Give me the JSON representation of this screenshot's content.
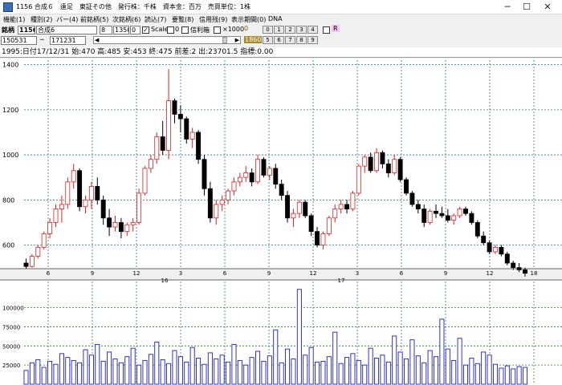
{
  "window": {
    "title": "1156 合成６　遠足　東証その他　発行株：千株　資本金：百万　売買単位：1株",
    "minimize": "─",
    "maximize": "☐",
    "close": "✕"
  },
  "menu": [
    "機能(1)",
    "種別(2)",
    "バー(4)",
    "前銘柄(5)",
    "次銘柄(6)",
    "読込(7)",
    "要覧(8)",
    "信用残(9)",
    "表示期間(0)",
    "DNA"
  ],
  "toolbar": {
    "code_label": "銘柄",
    "code_value": "1156",
    "name_value": "合成6",
    "field_a": "8",
    "field_b": "1350",
    "field_c": "0",
    "scale_label": "Scale",
    "field_d": "0",
    "credit_label": "信利箱",
    "x1000_label": "×1000",
    "num_top": "0",
    "num_badge": "1860",
    "buttons_row1": [
      "0",
      "1",
      "2",
      "3",
      "4"
    ],
    "buttons_row2": [
      "5",
      "6",
      "7",
      "8",
      "9"
    ],
    "r_label": "R",
    "start_date": "150531",
    "dash": "─",
    "end_date": "171231",
    "scroll_left": "◀",
    "scroll_right": "▶"
  },
  "infobar": "1995:日付17/12/31 始:470 高:485 安:453 終:475 前差:2 出:23701.5 指標:0.00",
  "colors": {
    "up": "#dd2222",
    "down": "#000000",
    "grid": "#2c7a86",
    "volume": "#1c1ccc",
    "bg": "#ffffff"
  },
  "chart_data": {
    "type": "candlestick",
    "price_ticks": [
      600,
      800,
      1000,
      1200,
      1400
    ],
    "price_range": [
      520,
      1420
    ],
    "month_ticks": [
      "6",
      "9",
      "12",
      "3",
      "6",
      "9",
      "12",
      "3",
      "6",
      "9",
      "12",
      "18"
    ],
    "year_labels": [
      {
        "label": "16",
        "month_index": 2
      },
      {
        "label": "17",
        "month_index": 6
      },
      {
        "label": "18",
        "month_index": 11
      }
    ],
    "volume_ticks": [
      25000,
      50000,
      75000,
      100000
    ],
    "volume_labels": [
      "25000",
      "50000",
      "75000",
      "100000"
    ],
    "volume_range": [
      0,
      130000
    ],
    "start_month_index": -0.5,
    "candles": [
      [
        520,
        540,
        495,
        505
      ],
      [
        505,
        560,
        500,
        550
      ],
      [
        550,
        600,
        540,
        590
      ],
      [
        590,
        660,
        580,
        650
      ],
      [
        650,
        720,
        630,
        700
      ],
      [
        700,
        780,
        680,
        760
      ],
      [
        760,
        820,
        700,
        780
      ],
      [
        780,
        900,
        760,
        880
      ],
      [
        880,
        960,
        850,
        930
      ],
      [
        930,
        940,
        750,
        770
      ],
      [
        770,
        820,
        740,
        800
      ],
      [
        800,
        880,
        760,
        860
      ],
      [
        860,
        900,
        780,
        800
      ],
      [
        800,
        820,
        690,
        720
      ],
      [
        720,
        760,
        640,
        680
      ],
      [
        680,
        730,
        660,
        700
      ],
      [
        700,
        720,
        630,
        660
      ],
      [
        660,
        700,
        640,
        690
      ],
      [
        690,
        720,
        660,
        700
      ],
      [
        700,
        850,
        690,
        830
      ],
      [
        830,
        950,
        820,
        940
      ],
      [
        940,
        1000,
        920,
        980
      ],
      [
        980,
        1100,
        960,
        1080
      ],
      [
        1080,
        1150,
        1000,
        1020
      ],
      [
        1020,
        1380,
        980,
        1240
      ],
      [
        1240,
        1250,
        1140,
        1180
      ],
      [
        1180,
        1220,
        1100,
        1160
      ],
      [
        1160,
        1170,
        1050,
        1070
      ],
      [
        1070,
        1120,
        1030,
        1100
      ],
      [
        1100,
        1110,
        960,
        980
      ],
      [
        980,
        1000,
        820,
        850
      ],
      [
        850,
        880,
        700,
        720
      ],
      [
        720,
        800,
        690,
        780
      ],
      [
        780,
        820,
        750,
        800
      ],
      [
        800,
        850,
        780,
        840
      ],
      [
        840,
        900,
        820,
        880
      ],
      [
        880,
        920,
        860,
        900
      ],
      [
        900,
        950,
        880,
        920
      ],
      [
        920,
        940,
        860,
        880
      ],
      [
        880,
        1000,
        870,
        980
      ],
      [
        980,
        990,
        900,
        910
      ],
      [
        910,
        950,
        890,
        940
      ],
      [
        940,
        960,
        850,
        870
      ],
      [
        870,
        890,
        800,
        820
      ],
      [
        820,
        840,
        700,
        720
      ],
      [
        720,
        760,
        680,
        740
      ],
      [
        740,
        800,
        720,
        790
      ],
      [
        790,
        800,
        720,
        730
      ],
      [
        730,
        740,
        640,
        660
      ],
      [
        660,
        680,
        590,
        600
      ],
      [
        600,
        660,
        580,
        650
      ],
      [
        650,
        730,
        640,
        720
      ],
      [
        720,
        780,
        700,
        760
      ],
      [
        760,
        800,
        740,
        780
      ],
      [
        780,
        800,
        740,
        760
      ],
      [
        760,
        840,
        750,
        830
      ],
      [
        830,
        960,
        820,
        950
      ],
      [
        950,
        1000,
        920,
        990
      ],
      [
        990,
        1010,
        920,
        930
      ],
      [
        930,
        1030,
        920,
        1010
      ],
      [
        1010,
        1020,
        940,
        960
      ],
      [
        960,
        980,
        900,
        920
      ],
      [
        920,
        1000,
        910,
        980
      ],
      [
        980,
        990,
        880,
        890
      ],
      [
        890,
        900,
        820,
        830
      ],
      [
        830,
        840,
        770,
        780
      ],
      [
        780,
        800,
        740,
        760
      ],
      [
        760,
        780,
        680,
        700
      ],
      [
        700,
        760,
        690,
        750
      ],
      [
        750,
        780,
        720,
        740
      ],
      [
        740,
        770,
        720,
        730
      ],
      [
        730,
        760,
        700,
        710
      ],
      [
        710,
        740,
        690,
        730
      ],
      [
        730,
        770,
        720,
        760
      ],
      [
        760,
        770,
        730,
        740
      ],
      [
        740,
        750,
        690,
        700
      ],
      [
        700,
        710,
        630,
        640
      ],
      [
        640,
        660,
        600,
        610
      ],
      [
        610,
        620,
        560,
        570
      ],
      [
        570,
        600,
        560,
        590
      ],
      [
        590,
        600,
        550,
        560
      ],
      [
        560,
        570,
        510,
        520
      ],
      [
        520,
        530,
        490,
        500
      ],
      [
        500,
        520,
        480,
        490
      ],
      [
        490,
        500,
        460,
        475
      ]
    ],
    "volumes": [
      18000,
      28000,
      32000,
      22000,
      30000,
      26000,
      40000,
      35000,
      31000,
      28000,
      45000,
      38000,
      52000,
      30000,
      42000,
      33000,
      28000,
      36000,
      47000,
      25000,
      31000,
      39000,
      55000,
      32000,
      27000,
      44000,
      36000,
      29000,
      48000,
      34000,
      26000,
      41000,
      33000,
      38000,
      29000,
      52000,
      31000,
      25000,
      35000,
      43000,
      30000,
      37000,
      71000,
      28000,
      46000,
      33000,
      124000,
      38000,
      48000,
      29000,
      30000,
      36000,
      68000,
      27000,
      35000,
      40000,
      31000,
      25000,
      47000,
      34000,
      38000,
      29000,
      63000,
      42000,
      33000,
      58000,
      37000,
      28000,
      44000,
      36000,
      85000,
      46000,
      31000,
      60000,
      25000,
      34000,
      27000,
      42000,
      38000,
      26000,
      21000,
      24000,
      20000,
      23000,
      22000
    ]
  }
}
